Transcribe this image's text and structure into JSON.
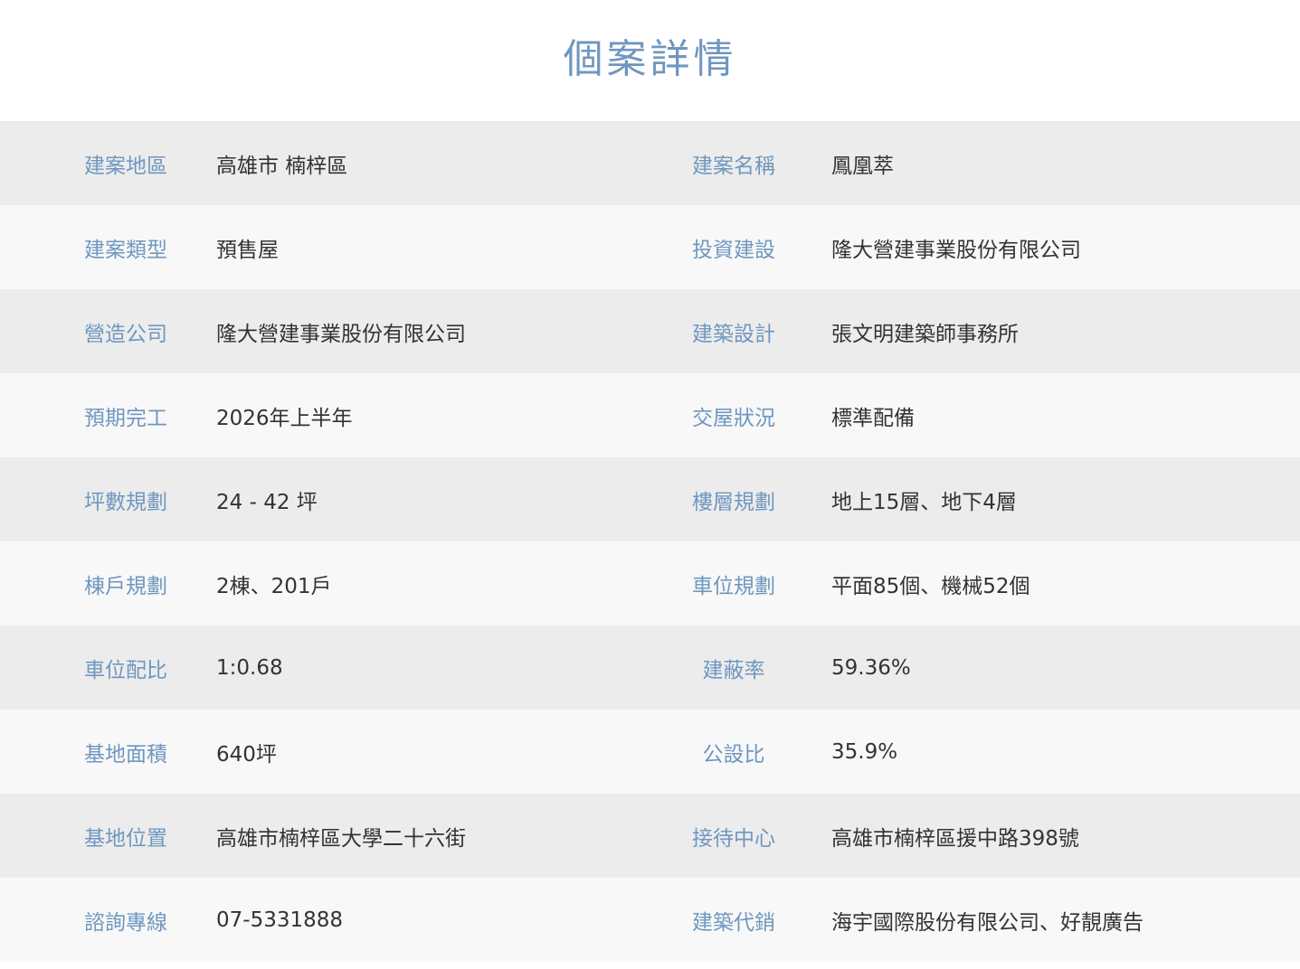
{
  "page": {
    "title": "個案詳情"
  },
  "rows": [
    {
      "left": {
        "label": "建案地區",
        "value": "高雄市 楠梓區"
      },
      "right": {
        "label": "建案名稱",
        "value": "鳳凰萃"
      }
    },
    {
      "left": {
        "label": "建案類型",
        "value": "預售屋"
      },
      "right": {
        "label": "投資建設",
        "value": "隆大營建事業股份有限公司"
      }
    },
    {
      "left": {
        "label": "營造公司",
        "value": "隆大營建事業股份有限公司"
      },
      "right": {
        "label": "建築設計",
        "value": "張文明建築師事務所"
      }
    },
    {
      "left": {
        "label": "預期完工",
        "value": "2026年上半年"
      },
      "right": {
        "label": "交屋狀況",
        "value": "標準配備"
      }
    },
    {
      "left": {
        "label": "坪數規劃",
        "value": "24 - 42 坪"
      },
      "right": {
        "label": "樓層規劃",
        "value": "地上15層、地下4層"
      }
    },
    {
      "left": {
        "label": "棟戶規劃",
        "value": "2棟、201戶"
      },
      "right": {
        "label": "車位規劃",
        "value": "平面85個、機械52個"
      }
    },
    {
      "left": {
        "label": "車位配比",
        "value": "1:0.68"
      },
      "right": {
        "label": "建蔽率",
        "value": "59.36%"
      }
    },
    {
      "left": {
        "label": "基地面積",
        "value": "640坪"
      },
      "right": {
        "label": "公設比",
        "value": "35.9%"
      }
    },
    {
      "left": {
        "label": "基地位置",
        "value": "高雄市楠梓區大學二十六街"
      },
      "right": {
        "label": "接待中心",
        "value": "高雄市楠梓區援中路398號"
      }
    },
    {
      "left": {
        "label": "諮詢專線",
        "value": "07-5331888"
      },
      "right": {
        "label": "建築代銷",
        "value": "海宇國際股份有限公司、好靚廣告"
      }
    }
  ]
}
